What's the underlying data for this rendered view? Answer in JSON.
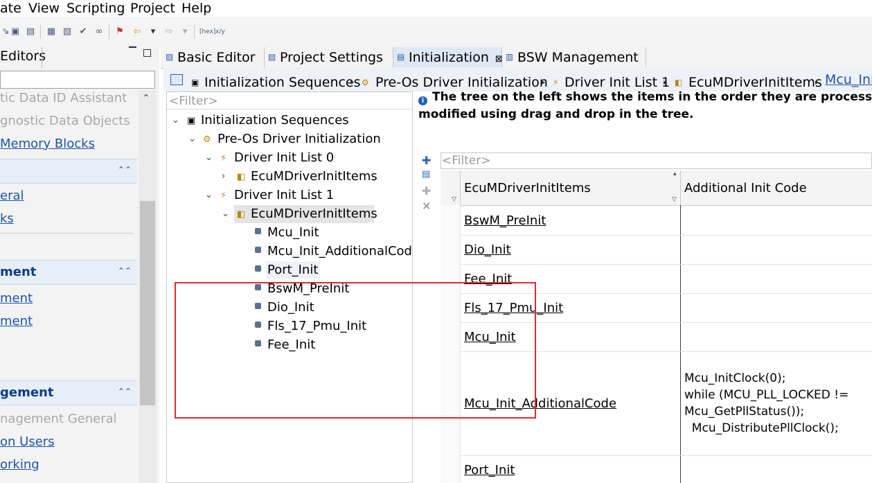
{
  "menubar": {
    "items": [
      "ate",
      "View",
      "Scripting",
      "Project",
      "Help"
    ]
  },
  "toolbar": {
    "icons": [
      "open-icon",
      "package-icon",
      "save-all-icon",
      "properties-icon",
      "validate-icon",
      "check-icon",
      "binoculars-icon",
      "back-history-icon",
      "back-icon",
      "dropdown-icon",
      "forward-icon",
      "dropdown-icon",
      "hex-icon",
      "format-icon"
    ]
  },
  "left_panel": {
    "title": "Editors",
    "links_top": [
      {
        "label": "tic Data ID Assistant",
        "disabled": true
      },
      {
        "label": "gnostic Data Objects",
        "disabled": true
      },
      {
        "label": "Memory Blocks",
        "disabled": false
      }
    ],
    "section1_links": [
      "eral",
      "ks"
    ],
    "section2_title": "ment",
    "section2_links": [
      "ment",
      "ment"
    ],
    "section3_title": "gement",
    "section3_links": [
      {
        "label": "nagement General",
        "disabled": true
      },
      {
        "label": "on Users",
        "disabled": false
      },
      {
        "label": "orking",
        "disabled": false
      }
    ]
  },
  "tabs": [
    {
      "label": "Basic Editor",
      "active": false
    },
    {
      "label": "Project Settings",
      "active": false
    },
    {
      "label": "Initialization",
      "active": true,
      "close": "⊠"
    },
    {
      "label": "BSW Management",
      "active": false
    }
  ],
  "breadcrumb": [
    "Initialization Sequences",
    "Pre-Os Driver Initialization",
    "Driver Init List 1",
    "EcuMDriverInitItems",
    "Mcu_Init"
  ],
  "tree": {
    "filter_placeholder": "<Filter>",
    "nodes": [
      {
        "label": "Initialization Sequences",
        "level": 0,
        "toggle": "⌄"
      },
      {
        "label": "Pre-Os Driver Initialization",
        "level": 1,
        "toggle": "⌄"
      },
      {
        "label": "Driver Init List 0",
        "level": 2,
        "toggle": "⌄"
      },
      {
        "label": "EcuMDriverInitItems",
        "level": 3,
        "toggle": "›"
      },
      {
        "label": "Driver Init List 1",
        "level": 2,
        "toggle": "⌄"
      },
      {
        "label": "EcuMDriverInitItems",
        "level": 3,
        "toggle": "⌄",
        "selected": true
      },
      {
        "label": "Mcu_Init",
        "level": 4
      },
      {
        "label": "Mcu_Init_AdditionalCod",
        "level": 4
      },
      {
        "label": "Port_Init",
        "level": 4,
        "highlight": true
      },
      {
        "label": "BswM_PreInit",
        "level": 4
      },
      {
        "label": "Dio_Init",
        "level": 4
      },
      {
        "label": "Fls_17_Pmu_Init",
        "level": 4
      },
      {
        "label": "Fee_Init",
        "level": 4
      }
    ]
  },
  "info": {
    "line1": "The tree on the left shows the items in the order they are processed in.",
    "line2": "modified using drag and drop in the tree."
  },
  "table": {
    "filter_placeholder": "<Filter>",
    "columns": [
      "EcuMDriverInitItems",
      "Additional Init Code"
    ],
    "rows": [
      "BswM_PreInit",
      "Dio_Init",
      "Fee_Init",
      "Fls_17_Pmu_Init",
      "Mcu_Init",
      "Mcu_Init_AdditionalCode",
      "Port_Init"
    ],
    "code_lines": [
      "Mcu_InitClock(0);",
      "while (MCU_PLL_LOCKED !=",
      "Mcu_GetPllStatus());",
      "  Mcu_DistributePllClock();"
    ]
  },
  "colors": {
    "link": "#1b54a8",
    "section": "#0f3b86",
    "annotation": "#e0282e"
  }
}
